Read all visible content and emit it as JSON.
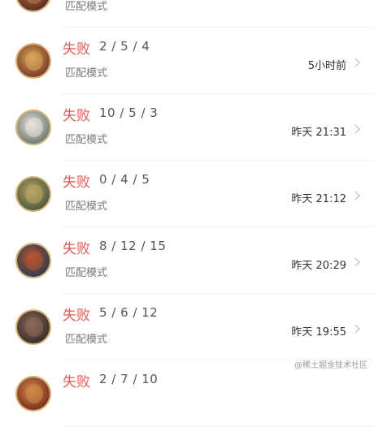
{
  "items": [
    {
      "result": "",
      "kda": "",
      "mode": "匹配模式",
      "time": "",
      "avatar_colors": [
        "#5a2a24",
        "#b8774a"
      ]
    },
    {
      "result": "失败",
      "kda": "2 / 5 / 4",
      "mode": "匹配模式",
      "time": "5小时前",
      "avatar_colors": [
        "#7b3b26",
        "#d9a55c"
      ]
    },
    {
      "result": "失败",
      "kda": "10 / 5 / 3",
      "mode": "匹配模式",
      "time": "昨天 21:31",
      "avatar_colors": [
        "#6f7a70",
        "#e8e4dc"
      ]
    },
    {
      "result": "失败",
      "kda": "0 / 4 / 5",
      "mode": "匹配模式",
      "time": "昨天 21:12",
      "avatar_colors": [
        "#4d5a3a",
        "#b9a46a"
      ]
    },
    {
      "result": "失败",
      "kda": "8 / 12 / 15",
      "mode": "匹配模式",
      "time": "昨天 20:29",
      "avatar_colors": [
        "#2e3c4f",
        "#b6542f"
      ]
    },
    {
      "result": "失败",
      "kda": "5 / 6 / 12",
      "mode": "匹配模式",
      "time": "昨天 19:55",
      "avatar_colors": [
        "#3b2d2b",
        "#8a6a58"
      ]
    },
    {
      "result": "失败",
      "kda": "2 / 7 / 10",
      "mode": "",
      "time": "",
      "avatar_colors": [
        "#7a2f1e",
        "#d08a48"
      ]
    }
  ],
  "watermark": "@稀土掘金技术社区",
  "colors": {
    "loss": "#e05a55",
    "avatar_border": "#d4b070"
  }
}
